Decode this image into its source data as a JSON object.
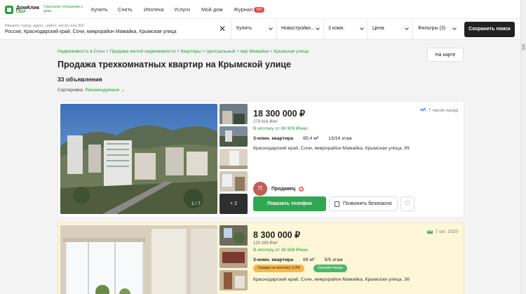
{
  "header": {
    "logo_name": "ДомКлик",
    "logo_sub": "СБЕР",
    "logo_slogan": "Серьезное отношение к дому",
    "nav": [
      {
        "label": "Купить"
      },
      {
        "label": "Снять"
      },
      {
        "label": "Ипотека"
      },
      {
        "label": "Услуги"
      },
      {
        "label": "Мой дом"
      },
      {
        "label": "Журнал",
        "badge": "162"
      }
    ],
    "accent": "#21a038"
  },
  "search": {
    "placeholder": "Введите город, адрес, район, метро или ЖК",
    "value": "Россия, Краснодарский край, Сочи, микрорайон Мамайка, Крымская улица",
    "deal": "Купить",
    "type": "Новостройки...",
    "rooms": "3 комн.",
    "price": "Цена",
    "filters": "Фильтры (3)",
    "save_button": "Сохранить поиск"
  },
  "breadcrumb": [
    "Недвижимость в Сочи",
    "Продажа жилой недвижимости",
    "Квартиры",
    "Центральный",
    "мкр Мамайка",
    "Крымская улица"
  ],
  "map_button": "На карте",
  "title": "Продажа трехкомнатных квартир на Крымской улице",
  "count": "33 объявления",
  "sort": {
    "label": "Сортировка:",
    "value": "Рекомендуемые"
  },
  "listings": [
    {
      "price": "18 300 000 ₽",
      "price_per_m": "279 816 ₽/м²",
      "mortgage": "В ипотеку от 96 909 ₽/мес",
      "rooms": "3-комн. квартира",
      "area": "65,4 м²",
      "floor": "13/14 этаж",
      "address": "Краснодарский край, Сочи, микрорайон Мамайка, Крымская улица, 89",
      "time": "7 часов назад",
      "photo_counter": "1 / 7",
      "more_photos": "+ 2",
      "seller_initial": "П",
      "seller_name": "Продавец",
      "show_phone": "Показать телефон",
      "call_free": "Позвонить безопасно"
    },
    {
      "price": "8 300 000 ₽",
      "price_per_m": "120 289 ₽/м²",
      "mortgage": "В ипотеку от 38 658 ₽/мес",
      "rooms": "3-комн. квартира",
      "area": "69 м²",
      "floor": "5/5 этаж",
      "tag_discount": "Скидка на ипотеку 0,3%",
      "tag_online": "Онлайн-показ",
      "address": "Краснодарский край, Сочи, микрорайон Мамайка, Крымская улица, 36",
      "time": "7 окт. 2020"
    }
  ]
}
